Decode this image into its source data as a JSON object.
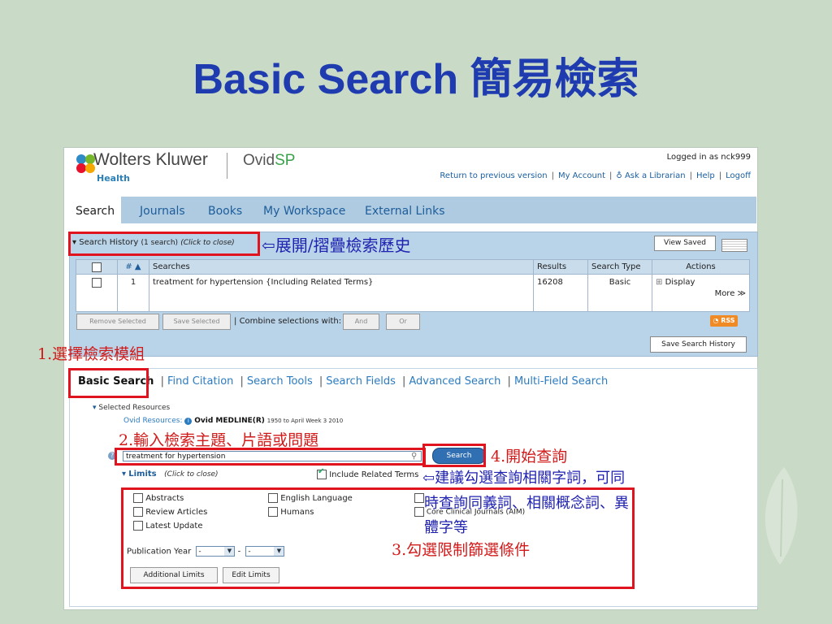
{
  "slide": {
    "title": "Basic Search 簡易檢索"
  },
  "header": {
    "brand": "Wolters Kluwer",
    "brand_sub": "Health",
    "product_prefix": "Ovid",
    "product_suffix": "SP",
    "logged_in": "Logged in as nck999",
    "links": [
      "Return to previous version",
      "My Account",
      "Ask a Librarian",
      "Help",
      "Logoff"
    ]
  },
  "nav": {
    "tabs": [
      "Search",
      "Journals",
      "Books",
      "My Workspace",
      "External Links"
    ]
  },
  "history": {
    "title": "Search History",
    "count_text": "(1 search)",
    "toggle_text": "(Click to close)",
    "view_saved": "View Saved",
    "columns": [
      "# ▲",
      "Searches",
      "Results",
      "Search Type",
      "Actions"
    ],
    "rows": [
      {
        "num": "1",
        "search": "treatment for hypertension {Including Related Terms}",
        "results": "16208",
        "type": "Basic",
        "action": "Display",
        "more": "More ≫"
      }
    ],
    "remove_selected": "Remove Selected",
    "save_selected": "Save Selected",
    "combine_label": "Combine selections with:",
    "and": "And",
    "or": "Or",
    "rss": "RSS",
    "save_history": "Save Search History"
  },
  "search": {
    "tabs": [
      "Basic Search",
      "Find Citation",
      "Search Tools",
      "Search Fields",
      "Advanced Search",
      "Multi-Field Search"
    ],
    "selected_resources": "Selected Resources",
    "ovid_resources_label": "Ovid Resources:",
    "resource_name": "Ovid MEDLINE(R)",
    "resource_range": "1950 to April Week 3 2010",
    "query": "treatment for hypertension",
    "search_button": "Search",
    "limits_label": "Limits",
    "limits_toggle": "(Click to close)",
    "include_related": "Include Related Terms",
    "limits_col1": [
      "Abstracts",
      "Review Articles",
      "Latest Update"
    ],
    "limits_col2": [
      "English Language",
      "Humans"
    ],
    "limits_col3": [
      "Core Clinical Journals (AIM)"
    ],
    "pub_year_label": "Publication Year",
    "pub_year_from": "-",
    "pub_year_to": "-",
    "additional_limits": "Additional Limits",
    "edit_limits": "Edit Limits"
  },
  "annotations": {
    "history_toggle": "⇦展開/摺疊檢索歷史",
    "step1": "1.選擇檢索模組",
    "step2": "2.輸入檢索主題、片語或問題",
    "step4": "4.開始查詢",
    "related_note": "⇦建議勾選查詢相關字詞，可同",
    "related_note2": "時查詢同義詞、相關概念詞、異",
    "related_note3": "體字等",
    "step3": "3.勾選限制篩選條件"
  },
  "colors": {
    "title_blue": "#1f3bb0",
    "annotation_red": "#d11a1a",
    "annotation_blue": "#2022b0",
    "highlight_box": "#e0141e"
  }
}
